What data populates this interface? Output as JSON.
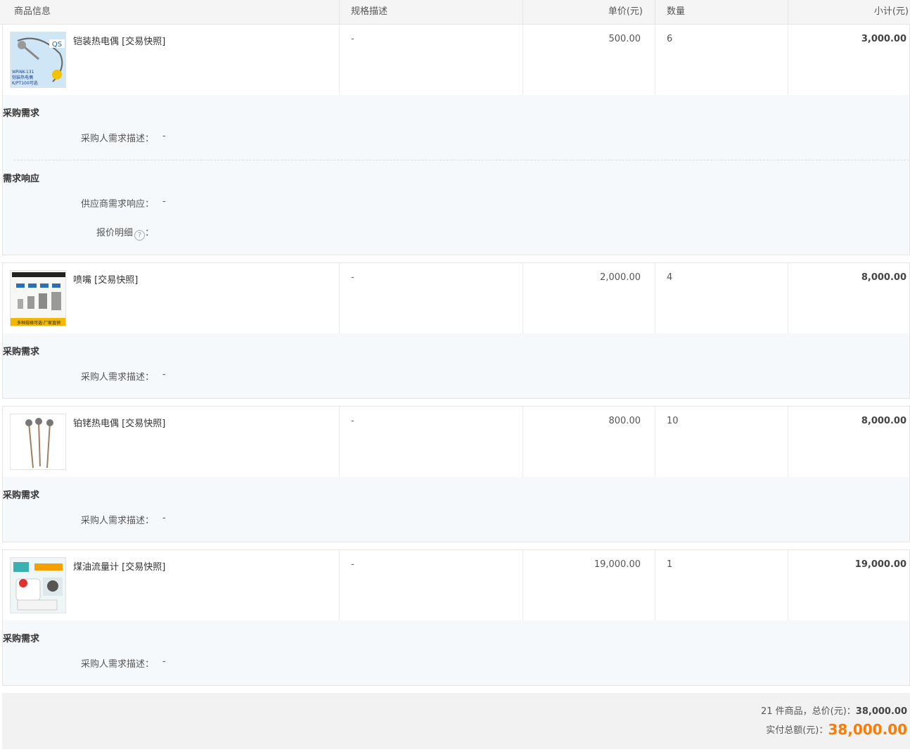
{
  "header": {
    "product_info": "商品信息",
    "spec": "规格描述",
    "unit_price": "单价(元)",
    "quantity": "数量",
    "subtotal": "小计(元)"
  },
  "labels": {
    "purchase_req": "采购需求",
    "buyer_desc": "采购人需求描述：",
    "req_response": "需求响应",
    "supplier_resp": "供应商需求响应：",
    "quote_detail": "报价明细",
    "colon": "：",
    "dash": "-",
    "help_glyph": "?"
  },
  "items": [
    {
      "name": "铠装热电偶",
      "snapshot": "[交易快照]",
      "spec": "-",
      "price": "500.00",
      "qty": "6",
      "subtotal": "3,000.00",
      "buyer_desc": "-",
      "supplier_resp": "-",
      "thumb": {
        "logo": "QS",
        "caption1": "WRNK-131",
        "caption2": "铠装热电偶",
        "caption3": "K/PT100可选"
      }
    },
    {
      "name": "喷嘴",
      "snapshot": "[交易快照]",
      "spec": "-",
      "price": "2,000.00",
      "qty": "4",
      "subtotal": "8,000.00",
      "buyer_desc": "-",
      "thumb": {
        "banner": "多种规格可选·厂家直销"
      }
    },
    {
      "name": "铂铑热电偶",
      "snapshot": "[交易快照]",
      "spec": "-",
      "price": "800.00",
      "qty": "10",
      "subtotal": "8,000.00",
      "buyer_desc": "-"
    },
    {
      "name": "煤油流量计",
      "snapshot": "[交易快照]",
      "spec": "-",
      "price": "19,000.00",
      "qty": "1",
      "subtotal": "19,000.00",
      "buyer_desc": "-"
    }
  ],
  "summary": {
    "count_prefix": "21 件商品，总价(元)：",
    "total": "38,000.00",
    "paid_label": "实付总额(元)：",
    "paid": "38,000.00"
  }
}
